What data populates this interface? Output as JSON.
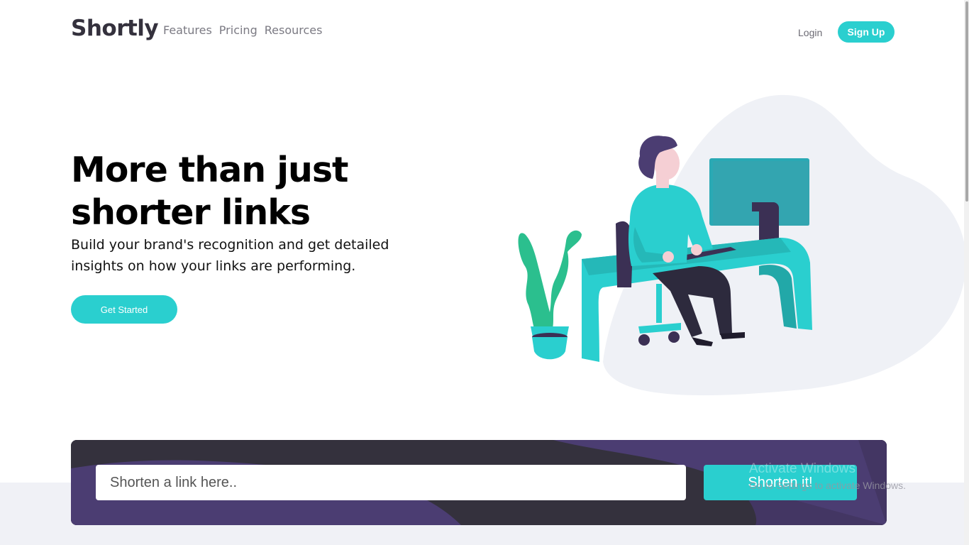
{
  "brand": {
    "name": "Shortly",
    "accent": "#2acfcf",
    "dark_violet": "#3b3054"
  },
  "nav": {
    "items": [
      {
        "label": "Features"
      },
      {
        "label": "Pricing"
      },
      {
        "label": "Resources"
      }
    ]
  },
  "auth": {
    "login": "Login",
    "signup": "Sign Up"
  },
  "hero": {
    "title": "More than just shorter links",
    "subtitle": "Build your brand's recognition and get detailed insights on how your links are performing.",
    "cta": "Get Started",
    "illustration": "person-working-at-desk-illustration"
  },
  "shorten": {
    "placeholder": "Shorten a link here..",
    "button": "Shorten it!"
  },
  "watermark": {
    "line1": "Activate Windows",
    "line2": "Go to Settings to activate Windows."
  }
}
